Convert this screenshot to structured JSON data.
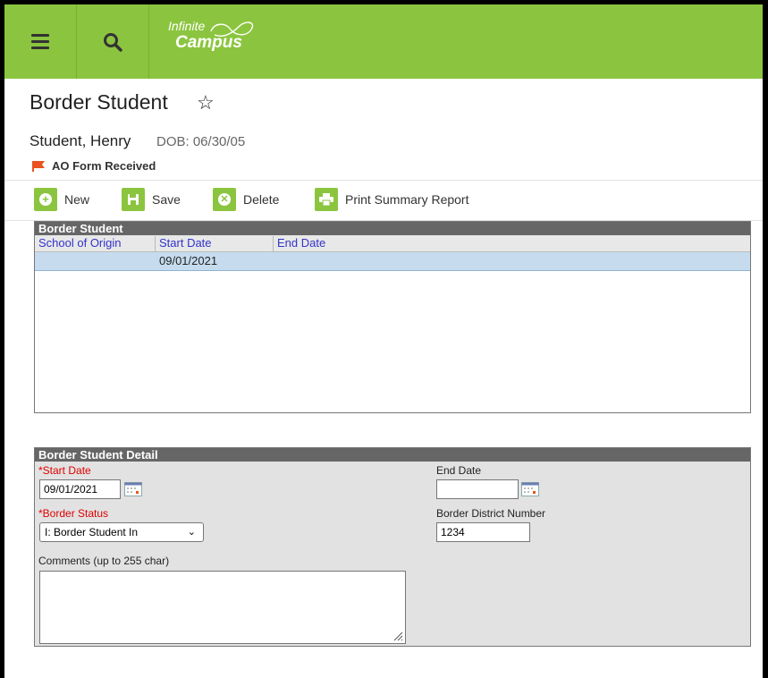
{
  "app": {
    "logo_line1": "Infinite",
    "logo_line2": "Campus"
  },
  "header": {
    "title": "Border Student",
    "student_name": "Student, Henry",
    "dob": "DOB: 06/30/05",
    "flag_label": "AO Form Received"
  },
  "toolbar": {
    "new_label": "New",
    "save_label": "Save",
    "delete_label": "Delete",
    "print_label": "Print Summary Report"
  },
  "list": {
    "title": "Border Student",
    "columns": [
      "School of Origin",
      "Start Date",
      "End Date"
    ],
    "rows": [
      {
        "school_of_origin": "",
        "start_date": "09/01/2021",
        "end_date": ""
      }
    ]
  },
  "detail": {
    "title": "Border Student Detail",
    "start_date_required": "*",
    "start_date_label": "Start Date",
    "start_date_value": "09/01/2021",
    "end_date_label": "End Date",
    "end_date_value": "",
    "border_status_required": "*",
    "border_status_label": "Border Status",
    "border_status_value": "I: Border Student In",
    "district_number_label": "Border District Number",
    "district_number_value": "1234",
    "comments_label": "Comments (up to 255 char)",
    "comments_value": ""
  },
  "colors": {
    "brand_green": "#8bc53f",
    "panel_header": "#666666",
    "selected_row": "#c6dcee",
    "required_red": "#e00000",
    "flag_orange": "#e8531f"
  },
  "icons": [
    "menu-icon",
    "search-icon",
    "star-icon",
    "flag-icon",
    "plus-icon",
    "save-icon",
    "delete-icon",
    "print-icon",
    "calendar-icon",
    "chevron-down-icon",
    "resize-grip-icon"
  ]
}
